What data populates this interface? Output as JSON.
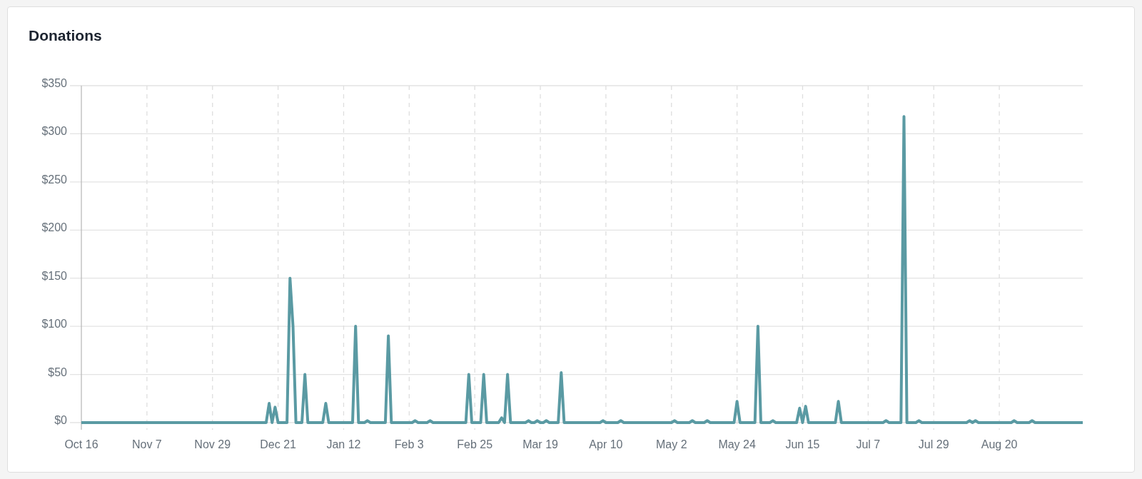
{
  "card": {
    "title": "Donations",
    "chart_data": {
      "type": "line",
      "grid": true,
      "ylim": [
        0,
        350
      ],
      "categories": [
        "Oct 16",
        null,
        null,
        null,
        null,
        null,
        null,
        null,
        null,
        null,
        null,
        null,
        null,
        null,
        null,
        null,
        null,
        null,
        null,
        null,
        null,
        null,
        "Nov 7",
        null,
        null,
        null,
        null,
        null,
        null,
        null,
        null,
        null,
        null,
        null,
        null,
        null,
        null,
        null,
        null,
        null,
        null,
        null,
        null,
        null,
        "Nov 29",
        null,
        null,
        null,
        null,
        null,
        null,
        null,
        null,
        null,
        null,
        null,
        null,
        null,
        null,
        null,
        null,
        null,
        null,
        null,
        null,
        null,
        "Dec 21",
        null,
        null,
        null,
        null,
        null,
        null,
        null,
        null,
        null,
        null,
        null,
        null,
        null,
        null,
        null,
        null,
        null,
        null,
        null,
        null,
        null,
        "Jan 12",
        null,
        null,
        null,
        null,
        null,
        null,
        null,
        null,
        null,
        null,
        null,
        null,
        null,
        null,
        null,
        null,
        null,
        null,
        null,
        null,
        null,
        "Feb 3",
        null,
        null,
        null,
        null,
        null,
        null,
        null,
        null,
        null,
        null,
        null,
        null,
        null,
        null,
        null,
        null,
        null,
        null,
        null,
        null,
        null,
        "Feb 25",
        null,
        null,
        null,
        null,
        null,
        null,
        null,
        null,
        null,
        null,
        null,
        null,
        null,
        null,
        null,
        null,
        null,
        null,
        null,
        null,
        null,
        "Mar 19",
        null,
        null,
        null,
        null,
        null,
        null,
        null,
        null,
        null,
        null,
        null,
        null,
        null,
        null,
        null,
        null,
        null,
        null,
        null,
        null,
        null,
        "Apr 10",
        null,
        null,
        null,
        null,
        null,
        null,
        null,
        null,
        null,
        null,
        null,
        null,
        null,
        null,
        null,
        null,
        null,
        null,
        null,
        null,
        null,
        "May 2",
        null,
        null,
        null,
        null,
        null,
        null,
        null,
        null,
        null,
        null,
        null,
        null,
        null,
        null,
        null,
        null,
        null,
        null,
        null,
        null,
        null,
        "May 24",
        null,
        null,
        null,
        null,
        null,
        null,
        null,
        null,
        null,
        null,
        null,
        null,
        null,
        null,
        null,
        null,
        null,
        null,
        null,
        null,
        null,
        "Jun 15",
        null,
        null,
        null,
        null,
        null,
        null,
        null,
        null,
        null,
        null,
        null,
        null,
        null,
        null,
        null,
        null,
        null,
        null,
        null,
        null,
        null,
        "Jul 7",
        null,
        null,
        null,
        null,
        null,
        null,
        null,
        null,
        null,
        null,
        null,
        null,
        null,
        null,
        null,
        null,
        null,
        null,
        null,
        null,
        null,
        "Jul 29",
        null,
        null,
        null,
        null,
        null,
        null,
        null,
        null,
        null,
        null,
        null,
        null,
        null,
        null,
        null,
        null,
        null,
        null,
        null,
        null,
        null,
        "Aug 20",
        null,
        null,
        null,
        null,
        null,
        null,
        null,
        null,
        null,
        null,
        null,
        null,
        null,
        null,
        null,
        null,
        null,
        null,
        null,
        null,
        null,
        null,
        null,
        null,
        null,
        null,
        null,
        null
      ],
      "yticks": [
        {
          "value": 0,
          "label": "$0"
        },
        {
          "value": 50,
          "label": "$50"
        },
        {
          "value": 100,
          "label": "$100"
        },
        {
          "value": 150,
          "label": "$150"
        },
        {
          "value": 200,
          "label": "$200"
        },
        {
          "value": 250,
          "label": "$250"
        },
        {
          "value": 300,
          "label": "$300"
        },
        {
          "value": 350,
          "label": "$350"
        }
      ],
      "series": [
        {
          "color": "#5a9aa3",
          "values": [
            0,
            0,
            0,
            0,
            0,
            0,
            0,
            0,
            0,
            0,
            0,
            0,
            0,
            0,
            0,
            0,
            0,
            0,
            0,
            0,
            0,
            0,
            0,
            0,
            0,
            0,
            0,
            0,
            0,
            0,
            0,
            0,
            0,
            0,
            0,
            0,
            0,
            0,
            0,
            0,
            0,
            0,
            0,
            0,
            0,
            0,
            0,
            0,
            0,
            0,
            0,
            0,
            0,
            0,
            0,
            0,
            0,
            0,
            0,
            0,
            0,
            0,
            0,
            20,
            0,
            16,
            0,
            0,
            0,
            0,
            150,
            100,
            0,
            0,
            0,
            50,
            0,
            0,
            0,
            0,
            0,
            0,
            20,
            0,
            0,
            0,
            0,
            0,
            0,
            0,
            0,
            0,
            100,
            0,
            0,
            0,
            2,
            0,
            0,
            0,
            0,
            0,
            0,
            90,
            0,
            0,
            0,
            0,
            0,
            0,
            0,
            0,
            2,
            0,
            0,
            0,
            0,
            2,
            0,
            0,
            0,
            0,
            0,
            0,
            0,
            0,
            0,
            0,
            0,
            0,
            50,
            0,
            0,
            0,
            0,
            50,
            0,
            0,
            0,
            0,
            0,
            5,
            0,
            50,
            0,
            0,
            0,
            0,
            0,
            0,
            2,
            0,
            0,
            2,
            0,
            0,
            2,
            0,
            0,
            0,
            0,
            52,
            0,
            0,
            0,
            0,
            0,
            0,
            0,
            0,
            0,
            0,
            0,
            0,
            0,
            2,
            0,
            0,
            0,
            0,
            0,
            2,
            0,
            0,
            0,
            0,
            0,
            0,
            0,
            0,
            0,
            0,
            0,
            0,
            0,
            0,
            0,
            0,
            0,
            2,
            0,
            0,
            0,
            0,
            0,
            2,
            0,
            0,
            0,
            0,
            2,
            0,
            0,
            0,
            0,
            0,
            0,
            0,
            0,
            0,
            22,
            0,
            0,
            0,
            0,
            0,
            0,
            100,
            0,
            0,
            0,
            0,
            2,
            0,
            0,
            0,
            0,
            0,
            0,
            0,
            0,
            15,
            0,
            17,
            0,
            0,
            0,
            0,
            0,
            0,
            0,
            0,
            0,
            0,
            22,
            0,
            0,
            0,
            0,
            0,
            0,
            0,
            0,
            0,
            0,
            0,
            0,
            0,
            0,
            0,
            2,
            0,
            0,
            0,
            0,
            0,
            318,
            0,
            0,
            0,
            0,
            2,
            0,
            0,
            0,
            0,
            0,
            0,
            0,
            0,
            0,
            0,
            0,
            0,
            0,
            0,
            0,
            0,
            2,
            0,
            2,
            0,
            0,
            0,
            0,
            0,
            0,
            0,
            0,
            0,
            0,
            0,
            0,
            2,
            0,
            0,
            0,
            0,
            0,
            2,
            0,
            0,
            0,
            0,
            0,
            0,
            0,
            0,
            0,
            0,
            0,
            0,
            0,
            0,
            0,
            0,
            0
          ]
        }
      ]
    }
  }
}
